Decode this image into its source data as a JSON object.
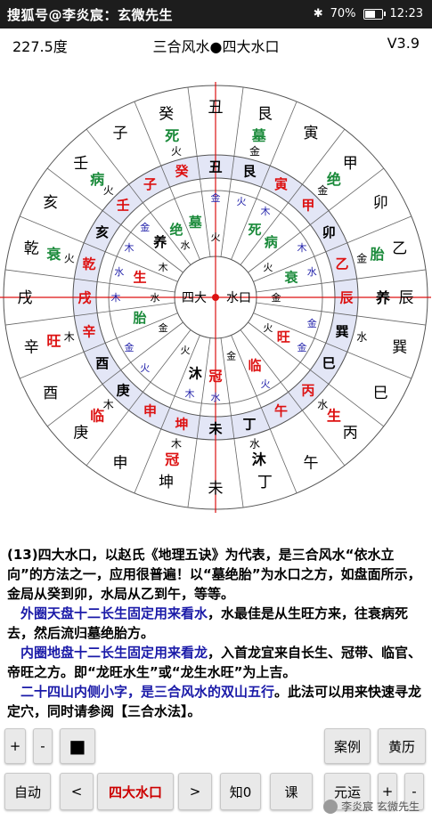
{
  "status_bar": {
    "left_text": "搜狐号@李炎宸：玄微先生",
    "battery": "70%",
    "battery_level": 0.7,
    "time": "12:23"
  },
  "header": {
    "degree": "227.5度",
    "title": "三合风水●四大水口",
    "version": "V3.9"
  },
  "colors": {
    "red": "#dd1111",
    "green": "#1a8a3a",
    "blue": "#2222aa",
    "ring_fill": "#e3e6f6"
  },
  "wheel": {
    "center_left": "四大",
    "center_right": "水口",
    "outer_mountains": [
      "子",
      "癸",
      "丑",
      "艮",
      "寅",
      "甲",
      "卯",
      "乙",
      "辰",
      "巽",
      "巳",
      "丙",
      "午",
      "丁",
      "未",
      "坤",
      "申",
      "庚",
      "酉",
      "辛",
      "戌",
      "乾",
      "亥",
      "壬"
    ],
    "outer_stages": [
      {
        "slot": 3,
        "text": "墓",
        "color": "green"
      },
      {
        "slot": 5,
        "text": "绝",
        "color": "green"
      },
      {
        "slot": 7,
        "text": "胎",
        "color": "green"
      },
      {
        "slot": 8,
        "text": "养",
        "color": "black"
      },
      {
        "slot": 11,
        "text": "生",
        "color": "red"
      },
      {
        "slot": 13,
        "text": "沐",
        "color": "black"
      },
      {
        "slot": 15,
        "text": "冠",
        "color": "red"
      },
      {
        "slot": 17,
        "text": "临",
        "color": "red"
      },
      {
        "slot": 19,
        "text": "旺",
        "color": "red"
      },
      {
        "slot": 21,
        "text": "衰",
        "color": "green"
      },
      {
        "slot": 23,
        "text": "病",
        "color": "green"
      },
      {
        "slot": 1,
        "text": "死",
        "color": "green"
      }
    ],
    "outer_elements": [
      {
        "slot": 3,
        "text": "金"
      },
      {
        "slot": 5,
        "text": "金"
      },
      {
        "slot": 7,
        "text": "金"
      },
      {
        "slot": 9,
        "text": "水"
      },
      {
        "slot": 11,
        "text": "水"
      },
      {
        "slot": 13,
        "text": "水"
      },
      {
        "slot": 15,
        "text": "木"
      },
      {
        "slot": 17,
        "text": "木"
      },
      {
        "slot": 19,
        "text": "木"
      },
      {
        "slot": 21,
        "text": "火"
      },
      {
        "slot": 23,
        "text": "火"
      },
      {
        "slot": 1,
        "text": "火"
      }
    ],
    "heaven_ring": [
      "子",
      "癸",
      "丑",
      "艮",
      "寅",
      "甲",
      "卯",
      "乙",
      "辰",
      "巽",
      "巳",
      "丙",
      "午",
      "丁",
      "未",
      "坤",
      "申",
      "庚",
      "酉",
      "辛",
      "戌",
      "乾",
      "亥",
      "壬"
    ],
    "heaven_red": [
      0,
      1,
      4,
      5,
      7,
      8,
      11,
      12,
      15,
      16,
      19,
      20,
      21,
      23
    ],
    "heaven_blue": [],
    "ring_elements": [
      {
        "slot": 2,
        "text": "金"
      },
      {
        "slot": 3,
        "text": "火"
      },
      {
        "slot": 4,
        "text": "木"
      },
      {
        "slot": 6,
        "text": "木"
      },
      {
        "slot": 7,
        "text": "水"
      },
      {
        "slot": 9,
        "text": "金"
      },
      {
        "slot": 10,
        "text": "金"
      },
      {
        "slot": 12,
        "text": "火"
      },
      {
        "slot": 14,
        "text": "水"
      },
      {
        "slot": 15,
        "text": "木"
      },
      {
        "slot": 17,
        "text": "火"
      },
      {
        "slot": 18,
        "text": "金"
      },
      {
        "slot": 20,
        "text": "木"
      },
      {
        "slot": 21,
        "text": "水"
      },
      {
        "slot": 22,
        "text": "木"
      },
      {
        "slot": 23,
        "text": "金"
      }
    ],
    "inner_mountains": [
      "绝",
      "墓",
      "丑",
      "艮",
      "死",
      "病",
      "卯",
      "衰",
      "乙",
      "金",
      "旺",
      "巳",
      "临",
      "丙",
      "冠",
      "沐",
      "未",
      "坤",
      "申",
      "庚",
      "酉",
      "生",
      "辛",
      "养"
    ],
    "inner_stages": [
      {
        "slot": 1,
        "text": "墓",
        "color": "green"
      },
      {
        "slot": 4,
        "text": "死",
        "color": "green"
      },
      {
        "slot": 5,
        "text": "病",
        "color": "green"
      },
      {
        "slot": 7,
        "text": "衰",
        "color": "green"
      },
      {
        "slot": 10,
        "text": "旺",
        "color": "red"
      },
      {
        "slot": 12,
        "text": "临",
        "color": "red"
      },
      {
        "slot": 14,
        "text": "冠",
        "color": "red"
      },
      {
        "slot": 15,
        "text": "沐",
        "color": "black"
      },
      {
        "slot": 21,
        "text": "生",
        "color": "red"
      },
      {
        "slot": 23,
        "text": "养",
        "color": "black"
      },
      {
        "slot": 0,
        "text": "绝",
        "color": "green"
      },
      {
        "slot": 19,
        "text": "胎",
        "color": "green"
      }
    ],
    "inner_elements": [
      {
        "slot": 0,
        "text": "水"
      },
      {
        "slot": 2,
        "text": "火"
      },
      {
        "slot": 6,
        "text": "火"
      },
      {
        "slot": 8,
        "text": "金"
      },
      {
        "slot": 10,
        "text": "火"
      },
      {
        "slot": 13,
        "text": "金"
      },
      {
        "slot": 16,
        "text": "火"
      },
      {
        "slot": 18,
        "text": "金"
      },
      {
        "slot": 20,
        "text": "水"
      },
      {
        "slot": 22,
        "text": "木"
      }
    ]
  },
  "description": {
    "p1": "(13)四大水口，以赵氏《地理五诀》为代表，是三合风水“依水立向”的方法之一，应用很普遍！以“墓绝胎”为水口之方，如盘面所示，金局从癸到卯，水局从乙到午，等等。",
    "p2_blue": "外圈天盘十二长生固定用来看水",
    "p2_rest": "，水最佳是从生旺方来，往衰病死去，然后流归墓绝胎方。",
    "p3_blue": "内圈地盘十二长生固定用来看龙",
    "p3_rest": "，入首龙宜来自长生、冠带、临官、帝旺之方。即“龙旺水生”或“龙生水旺”为上吉。",
    "p4_blue": "二十四山内侧小字，是三合风水的双山五行",
    "p4_rest": "。此法可以用来快速寻龙定穴，同时请参阅【三合水法】。"
  },
  "buttons": {
    "plus1": "+",
    "minus1": "-",
    "stop": "■",
    "cases": "案例",
    "almanac": "黄历",
    "auto": "自动",
    "prev": "<",
    "mode": "四大水口",
    "next": ">",
    "zhi0": "知0",
    "lesson": "课",
    "yuanyun": "元运",
    "plus2": "+",
    "minus2": "-"
  },
  "watermark": "李炎宸 玄微先生"
}
